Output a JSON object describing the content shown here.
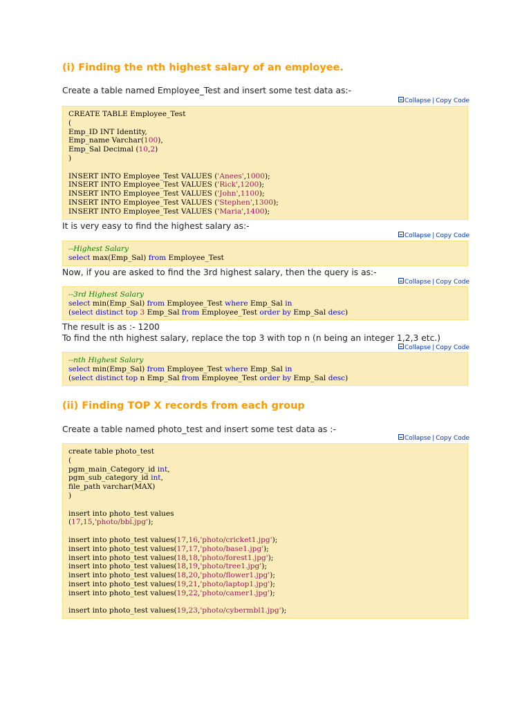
{
  "section1": {
    "heading": "(i) Finding the nth highest salary of an employee.",
    "intro": "Create a table named Employee_Test and insert some test data as:-",
    "highest_text": "It is very easy to find the highest salary as:-",
    "third_text": "Now, if you are asked to find the 3rd highest salary, then the query is as:-",
    "result_text": "The result is as :- 1200",
    "nth_text": "To find the nth highest salary, replace the top 3 with top n (n being an integer 1,2,3 etc.)"
  },
  "section2": {
    "heading": "(ii) Finding TOP X records from each group",
    "intro": "Create a table named photo_test and insert some test data as :-"
  },
  "controls": {
    "collapse": "Collapse",
    "separator": "|",
    "copy": "Copy Code"
  },
  "code_blocks": {
    "create_employee": [
      [
        [
          "CREATE TABLE Employee_Test",
          ""
        ]
      ],
      [
        [
          "(",
          ""
        ]
      ],
      [
        [
          "Emp_ID INT Identity,",
          ""
        ]
      ],
      [
        [
          "Emp_name Varchar(",
          ""
        ],
        [
          "100",
          "num"
        ],
        [
          "),",
          ""
        ]
      ],
      [
        [
          "Emp_Sal Decimal (",
          ""
        ],
        [
          "10",
          "num"
        ],
        [
          ",",
          ""
        ],
        [
          "2",
          "num"
        ],
        [
          ")",
          ""
        ]
      ],
      [
        [
          ")",
          ""
        ]
      ],
      [
        [
          "",
          ""
        ]
      ],
      [
        [
          "INSERT INTO Employee_Test VALUES (",
          ""
        ],
        [
          "'Anees'",
          "str"
        ],
        [
          ",",
          ""
        ],
        [
          "1000",
          "num"
        ],
        [
          ");",
          ""
        ]
      ],
      [
        [
          "INSERT INTO Employee_Test VALUES (",
          ""
        ],
        [
          "'Rick'",
          "str"
        ],
        [
          ",",
          ""
        ],
        [
          "1200",
          "num"
        ],
        [
          ");",
          ""
        ]
      ],
      [
        [
          "INSERT INTO Employee_Test VALUES (",
          ""
        ],
        [
          "'John'",
          "str"
        ],
        [
          ",",
          ""
        ],
        [
          "1100",
          "num"
        ],
        [
          ");",
          ""
        ]
      ],
      [
        [
          "INSERT INTO Employee_Test VALUES (",
          ""
        ],
        [
          "'Stephen'",
          "str"
        ],
        [
          ",",
          ""
        ],
        [
          "1300",
          "num"
        ],
        [
          ");",
          ""
        ]
      ],
      [
        [
          "INSERT INTO Employee_Test VALUES (",
          ""
        ],
        [
          "'Maria'",
          "str"
        ],
        [
          ",",
          ""
        ],
        [
          "1400",
          "num"
        ],
        [
          ");",
          ""
        ]
      ]
    ],
    "highest_salary": [
      [
        [
          "--Highest Salary",
          "cmt"
        ]
      ],
      [
        [
          "select",
          "kw"
        ],
        [
          " max(Emp_Sal) ",
          ""
        ],
        [
          "from",
          "kw"
        ],
        [
          " Employee_Test",
          ""
        ]
      ]
    ],
    "third_highest": [
      [
        [
          "--3rd Highest Salary",
          "cmt"
        ]
      ],
      [
        [
          "select",
          "kw"
        ],
        [
          " min(Emp_Sal) ",
          ""
        ],
        [
          "from",
          "kw"
        ],
        [
          " Employee_Test ",
          ""
        ],
        [
          "where",
          "kw"
        ],
        [
          " Emp_Sal ",
          ""
        ],
        [
          "in",
          "kw"
        ]
      ],
      [
        [
          "(",
          ""
        ],
        [
          "select",
          "kw"
        ],
        [
          " ",
          ""
        ],
        [
          "distinct",
          "kw"
        ],
        [
          " ",
          ""
        ],
        [
          "top",
          "kw"
        ],
        [
          " ",
          ""
        ],
        [
          "3",
          "num"
        ],
        [
          " Emp_Sal ",
          ""
        ],
        [
          "from",
          "kw"
        ],
        [
          " Employee_Test ",
          ""
        ],
        [
          "order",
          "kw"
        ],
        [
          " ",
          ""
        ],
        [
          "by",
          "kw"
        ],
        [
          " Emp_Sal ",
          ""
        ],
        [
          "desc",
          "kw"
        ],
        [
          ")",
          ""
        ]
      ]
    ],
    "nth_highest": [
      [
        [
          "--nth Highest Salary",
          "cmt"
        ]
      ],
      [
        [
          "select",
          "kw"
        ],
        [
          " min(Emp_Sal) ",
          ""
        ],
        [
          "from",
          "kw"
        ],
        [
          " Employee_Test ",
          ""
        ],
        [
          "where",
          "kw"
        ],
        [
          " Emp_Sal ",
          ""
        ],
        [
          "in",
          "kw"
        ]
      ],
      [
        [
          "(",
          ""
        ],
        [
          "select",
          "kw"
        ],
        [
          " ",
          ""
        ],
        [
          "distinct",
          "kw"
        ],
        [
          " ",
          ""
        ],
        [
          "top",
          "kw"
        ],
        [
          " n Emp_Sal ",
          ""
        ],
        [
          "from",
          "kw"
        ],
        [
          " Employee_Test ",
          ""
        ],
        [
          "order",
          "kw"
        ],
        [
          " ",
          ""
        ],
        [
          "by",
          "kw"
        ],
        [
          " Emp_Sal ",
          ""
        ],
        [
          "desc",
          "kw"
        ],
        [
          ")",
          ""
        ]
      ]
    ],
    "create_photo": [
      [
        [
          "create table photo_test",
          ""
        ]
      ],
      [
        [
          "(",
          ""
        ]
      ],
      [
        [
          "pgm_main_Category_id ",
          ""
        ],
        [
          "int",
          "kw"
        ],
        [
          ",",
          ""
        ]
      ],
      [
        [
          "pgm_sub_category_id ",
          ""
        ],
        [
          "int",
          "kw"
        ],
        [
          ",",
          ""
        ]
      ],
      [
        [
          "file_path varchar(MAX)",
          ""
        ]
      ],
      [
        [
          ")",
          ""
        ]
      ],
      [
        [
          "",
          ""
        ]
      ],
      [
        [
          "insert into photo_test values",
          ""
        ]
      ],
      [
        [
          "(",
          ""
        ],
        [
          "17",
          "num"
        ],
        [
          ",",
          ""
        ],
        [
          "15",
          "num"
        ],
        [
          ",",
          ""
        ],
        [
          "'photo/bbl.jpg'",
          "str"
        ],
        [
          ");",
          ""
        ]
      ],
      [
        [
          "",
          ""
        ]
      ],
      [
        [
          "insert into photo_test values(",
          ""
        ],
        [
          "17",
          "num"
        ],
        [
          ",",
          ""
        ],
        [
          "16",
          "num"
        ],
        [
          ",",
          ""
        ],
        [
          "'photo/cricket1.jpg'",
          "str"
        ],
        [
          ");",
          ""
        ]
      ],
      [
        [
          "insert into photo_test values(",
          ""
        ],
        [
          "17",
          "num"
        ],
        [
          ",",
          ""
        ],
        [
          "17",
          "num"
        ],
        [
          ",",
          ""
        ],
        [
          "'photo/base1.jpg'",
          "str"
        ],
        [
          ");",
          ""
        ]
      ],
      [
        [
          "insert into photo_test values(",
          ""
        ],
        [
          "18",
          "num"
        ],
        [
          ",",
          ""
        ],
        [
          "18",
          "num"
        ],
        [
          ",",
          ""
        ],
        [
          "'photo/forest1.jpg'",
          "str"
        ],
        [
          ");",
          ""
        ]
      ],
      [
        [
          "insert into photo_test values(",
          ""
        ],
        [
          "18",
          "num"
        ],
        [
          ",",
          ""
        ],
        [
          "19",
          "num"
        ],
        [
          ",",
          ""
        ],
        [
          "'photo/tree1.jpg'",
          "str"
        ],
        [
          ");",
          ""
        ]
      ],
      [
        [
          "insert into photo_test values(",
          ""
        ],
        [
          "18",
          "num"
        ],
        [
          ",",
          ""
        ],
        [
          "20",
          "num"
        ],
        [
          ",",
          ""
        ],
        [
          "'photo/flower1.jpg'",
          "str"
        ],
        [
          ");",
          ""
        ]
      ],
      [
        [
          "insert into photo_test values(",
          ""
        ],
        [
          "19",
          "num"
        ],
        [
          ",",
          ""
        ],
        [
          "21",
          "num"
        ],
        [
          ",",
          ""
        ],
        [
          "'photo/laptop1.jpg'",
          "str"
        ],
        [
          ");",
          ""
        ]
      ],
      [
        [
          "insert into photo_test values(",
          ""
        ],
        [
          "19",
          "num"
        ],
        [
          ",",
          ""
        ],
        [
          "22",
          "num"
        ],
        [
          ",",
          ""
        ],
        [
          "'photo/camer1.jpg'",
          "str"
        ],
        [
          ");",
          ""
        ]
      ],
      [
        [
          "",
          ""
        ]
      ],
      [
        [
          "insert into photo_test values(",
          ""
        ],
        [
          "19",
          "num"
        ],
        [
          ",",
          ""
        ],
        [
          "23",
          "num"
        ],
        [
          ",",
          ""
        ],
        [
          "'photo/cybermbl1.jpg'",
          "str"
        ],
        [
          ");",
          ""
        ]
      ]
    ]
  },
  "colors": {
    "heading": "#ff9900",
    "code_background": "#fbedbb",
    "code_border": "#fbe17e",
    "keyword": "#0000ff",
    "string": "#a3145a",
    "comment": "#008000",
    "link": "#0033cc"
  }
}
